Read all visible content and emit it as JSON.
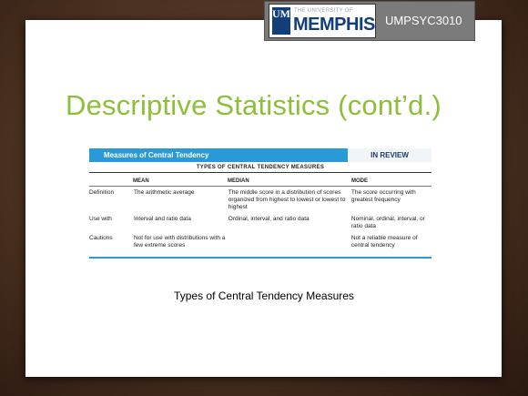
{
  "header": {
    "logo_small": "THE UNIVERSITY OF",
    "logo_big": "MEMPHIS",
    "logo_mark": "UM",
    "course": "UMPSYC3010"
  },
  "title": "Descriptive Statistics (cont’d.)",
  "figure": {
    "heading": "Measures of Central Tendency",
    "badge": "IN REVIEW",
    "subheading": "TYPES OF CENTRAL TENDENCY MEASURES",
    "columns": [
      "",
      "MEAN",
      "MEDIAN",
      "MODE"
    ],
    "rows": [
      [
        "Definition",
        "The arithmetic average",
        "The middle score in a distribution of scores organized from highest to lowest or lowest to highest",
        "The score occurring with greatest frequency"
      ],
      [
        "Use with",
        "Interval and ratio data",
        "Ordinal, interval, and ratio data",
        "Nominal, ordinal, interval, or ratio data"
      ],
      [
        "Cautions",
        "Not for use with distributions with a few extreme scores",
        "",
        "Not a reliable measure of central tendency"
      ]
    ]
  },
  "caption": "Types of Central Tendency Measures"
}
